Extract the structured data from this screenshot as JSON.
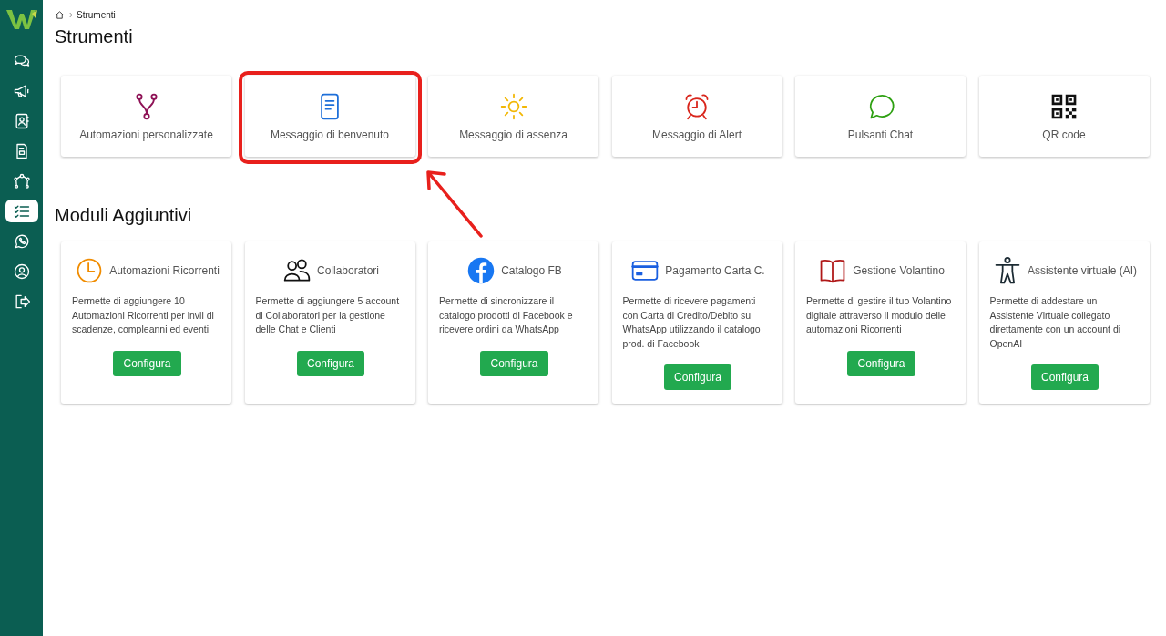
{
  "sidebar": {
    "items": [
      {
        "kind": "chats",
        "selected": false
      },
      {
        "kind": "megaphone",
        "selected": false
      },
      {
        "kind": "contacts",
        "selected": false
      },
      {
        "kind": "form",
        "selected": false
      },
      {
        "kind": "flow",
        "selected": false
      },
      {
        "kind": "checklist",
        "selected": true
      },
      {
        "kind": "whatsapp",
        "selected": false
      },
      {
        "kind": "account",
        "selected": false
      },
      {
        "kind": "logout",
        "selected": false
      }
    ]
  },
  "breadcrumb": {
    "current": "Strumenti"
  },
  "title": "Strumenti",
  "tools": [
    {
      "label": "Automazioni personalizzate",
      "kind": "branch",
      "highlighted": false
    },
    {
      "label": "Messaggio di benvenuto",
      "kind": "document",
      "highlighted": true
    },
    {
      "label": "Messaggio di assenza",
      "kind": "sun",
      "highlighted": false
    },
    {
      "label": "Messaggio di Alert",
      "kind": "alarm",
      "highlighted": false
    },
    {
      "label": "Pulsanti Chat",
      "kind": "chat",
      "highlighted": false
    },
    {
      "label": "QR code",
      "kind": "qr",
      "highlighted": false
    }
  ],
  "modules_title": "Moduli Aggiuntivi",
  "modules": [
    {
      "title": "Automazioni Ricorrenti",
      "kind": "clock",
      "description": "Permette di aggiungere 10 Automazioni Ricorrenti per invii di scadenze, compleanni ed eventi",
      "button": "Configura"
    },
    {
      "title": "Collaboratori",
      "kind": "people",
      "description": "Permette di aggiungere 5 account di Collaboratori per la gestione delle Chat e Clienti",
      "button": "Configura"
    },
    {
      "title": "Catalogo FB",
      "kind": "facebook",
      "description": "Permette di sincronizzare il catalogo prodotti di Facebook e ricevere ordini da WhatsApp",
      "button": "Configura"
    },
    {
      "title": "Pagamento Carta C.",
      "kind": "card",
      "description": "Permette di ricevere pagamenti con Carta di Credito/Debito su WhatsApp utilizzando il catalogo prod. di Facebook",
      "button": "Configura"
    },
    {
      "title": "Gestione Volantino",
      "kind": "book",
      "description": "Permette di gestire il tuo Volantino digitale attraverso il modulo delle automazioni Ricorrenti",
      "button": "Configura"
    },
    {
      "title": "Assistente virtuale (AI)",
      "kind": "person",
      "description": "Permette di addestare un Assistente Virtuale collegato direttamente con un account di OpenAI",
      "button": "Configura"
    }
  ]
}
